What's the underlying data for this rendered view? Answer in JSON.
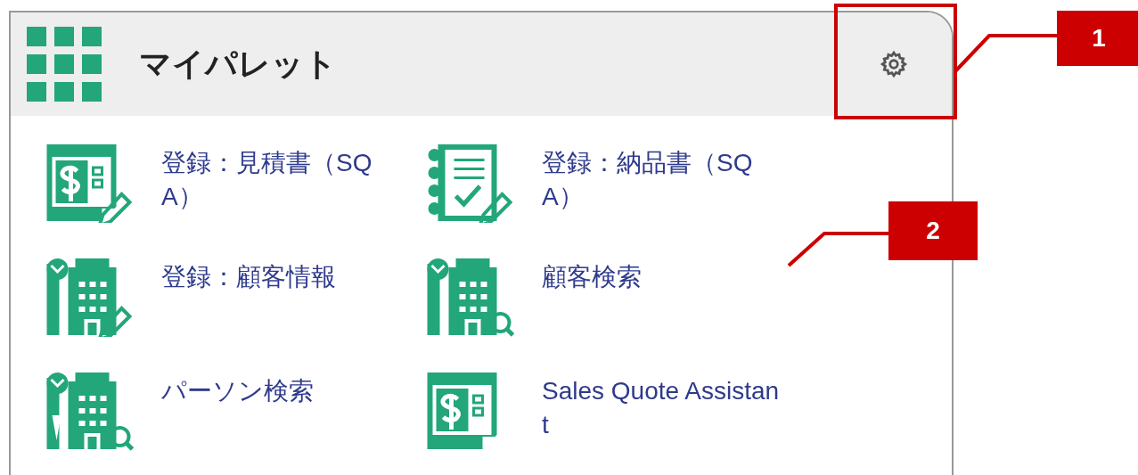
{
  "panel": {
    "title": "マイパレット",
    "settings_button": {
      "highlighted": true
    }
  },
  "items": [
    {
      "label": "登録：見積書（SQA）",
      "kind": "estimate"
    },
    {
      "label": "登録：納品書（SQA）",
      "kind": "delivery"
    },
    {
      "label": "登録：顧客情報",
      "kind": "customer"
    },
    {
      "label": "顧客検索",
      "kind": "customersearch"
    },
    {
      "label": "パーソン検索",
      "kind": "personsearch"
    },
    {
      "label": "Sales Quote Assistant",
      "kind": "quote"
    }
  ],
  "callouts": [
    {
      "label": "1"
    },
    {
      "label": "2"
    }
  ]
}
